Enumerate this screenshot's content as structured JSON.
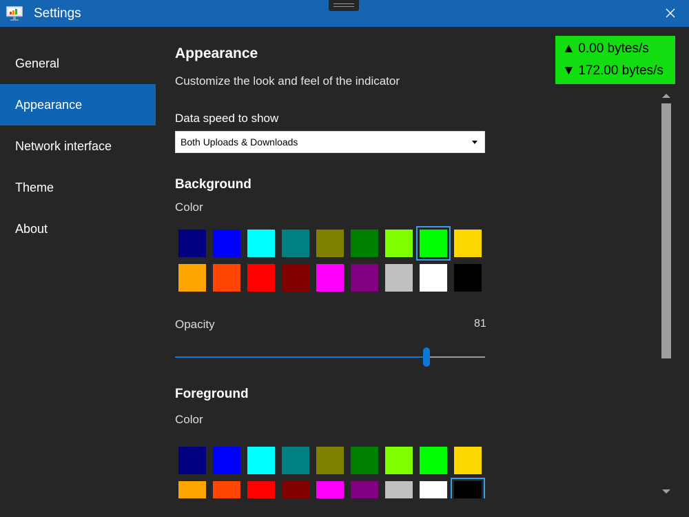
{
  "window": {
    "title": "Settings"
  },
  "sidebar": {
    "items": [
      {
        "label": "General",
        "active": false
      },
      {
        "label": "Appearance",
        "active": true
      },
      {
        "label": "Network interface",
        "active": false
      },
      {
        "label": "Theme",
        "active": false
      },
      {
        "label": "About",
        "active": false
      }
    ]
  },
  "page": {
    "title": "Appearance",
    "subtitle": "Customize the look and feel of the indicator",
    "data_speed_label": "Data speed to show",
    "data_speed_value": "Both Uploads & Downloads"
  },
  "background": {
    "heading": "Background",
    "color_label": "Color",
    "selected_color": "#00ff00",
    "opacity_label": "Opacity",
    "opacity_value": "81",
    "opacity_fraction": 0.81
  },
  "foreground": {
    "heading": "Foreground",
    "color_label": "Color",
    "selected_color": "#000000"
  },
  "palette": [
    "#000080",
    "#0000ff",
    "#00ffff",
    "#008080",
    "#808000",
    "#008000",
    "#7fff00",
    "#00ff00",
    "#ffd700",
    "#ffa500",
    "#ff4500",
    "#ff0000",
    "#800000",
    "#ff00ff",
    "#800080",
    "#c0c0c0",
    "#ffffff",
    "#000000"
  ],
  "indicator": {
    "upload_arrow": "▲",
    "upload": "0.00 bytes/s",
    "download_arrow": "▼",
    "download": "172.00 bytes/s",
    "background_color": "#11dd11",
    "text_color": "#000000"
  },
  "colors": {
    "accent": "#0f64b4",
    "titlebar": "#1565b3",
    "window_bg": "#262626"
  }
}
